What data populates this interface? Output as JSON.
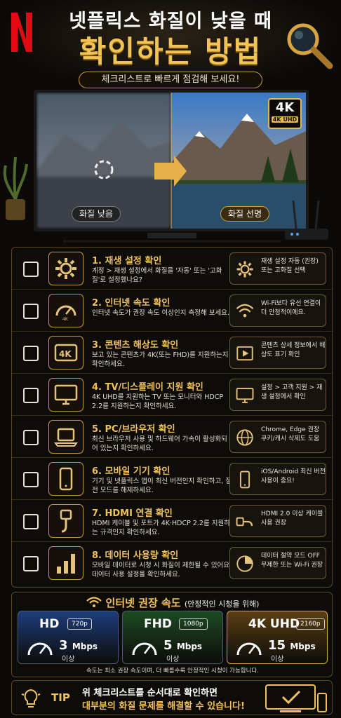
{
  "header": {
    "title_line1": "넷플릭스 화질이 낮을 때",
    "title_line2": "확인하는 방법",
    "subtitle": "체크리스트로 빠르게 점검해 보세요!"
  },
  "tv": {
    "badge_main": "4K",
    "badge_sub": "4K UHD",
    "label_low": "화질 낮음",
    "label_high": "화질 선명"
  },
  "checklist": [
    {
      "icon": "gear-icon",
      "title": "1. 재생 설정 확인",
      "desc": "계정 > 재생 설정에서 화질을 '자동' 또는 '고화질'로 설정했나요?",
      "tip_icon": "gear-icon",
      "tip": "재생 설정 자동 (권장) 또는 고화질 선택"
    },
    {
      "icon": "speedometer-icon",
      "title": "2. 인터넷 속도 확인",
      "desc": "인터넷 속도가 권장 속도 이상인지 측정해 보세요.",
      "tip_icon": "wifi-icon",
      "tip": "Wi-Fi보다 유선 연결이 더 안정적이에요."
    },
    {
      "icon": "4k-badge-icon",
      "title": "3. 콘텐츠 해상도 확인",
      "desc": "보고 있는 콘텐츠가 4K(또는 FHD)를 지원하는지 확인하세요.",
      "tip_icon": "film-icon",
      "tip": "콘텐츠 상세 정보에서 해상도 표기 확인"
    },
    {
      "icon": "monitor-icon",
      "title": "4. TV/디스플레이 지원 확인",
      "desc": "4K UHD를 지원하는 TV 또는 모니터와 HDCP 2.2를 지원하는지 확인하세요.",
      "tip_icon": "monitor-icon",
      "tip": "설정 > 고객 지원 > 재생 설정에서 확인"
    },
    {
      "icon": "laptop-icon",
      "title": "5. PC/브라우저 확인",
      "desc": "최신 브라우저 사용 및 하드웨어 가속이 활성화되어 있는지 확인하세요.",
      "tip_icon": "globe-icon",
      "tip": "Chrome, Edge 권장 쿠키/캐시 삭제도 도움"
    },
    {
      "icon": "phone-icon",
      "title": "6. 모바일 기기 확인",
      "desc": "기기 및 넷플릭스 앱이 최신 버전인지 확인하고, 절전 모드를 해제하세요.",
      "tip_icon": "phone-icon",
      "tip": "iOS/Android 최신 버전 사용이 중요!"
    },
    {
      "icon": "hdmi-icon",
      "title": "7. HDMI 연결 확인",
      "desc": "HDMI 케이블 및 포트가 4K·HDCP 2.2를 지원하는 규격인지 확인하세요.",
      "tip_icon": "cable-icon",
      "tip": "HDMI 2.0 이상 케이블 사용 권장"
    },
    {
      "icon": "bar-chart-icon",
      "title": "8. 데이터 사용량 확인",
      "desc": "모바일 데이터로 시청 시 화질이 제한될 수 있어요. 데이터 사용 설정을 확인하세요.",
      "tip_icon": "pie-chart-icon",
      "tip": "데이터 절약 모드 OFF 무제한 또는 Wi-Fi 권장"
    }
  ],
  "speed": {
    "title": "인터넷 권장 속도",
    "title_note": "(안정적인 시청을 위해)",
    "cards": [
      {
        "name": "HD",
        "res": "720p",
        "value": "3",
        "unit": "Mbps",
        "suffix": "이상",
        "color": "#1d3d7a"
      },
      {
        "name": "FHD",
        "res": "1080p",
        "value": "5",
        "unit": "Mbps",
        "suffix": "이상",
        "color": "#1d4a22"
      },
      {
        "name": "4K UHD",
        "res": "2160p",
        "value": "15",
        "unit": "Mbps",
        "suffix": "이상",
        "color": "#5a3f12"
      }
    ],
    "note": "속도는 최소 권장 속도이며, 더 빠를수록 안정적인 시청이 가능합니다."
  },
  "tipbar": {
    "label": "TIP",
    "line1": "위 체크리스트를 순서대로 확인하면",
    "line2": "대부분의 화질 문제를 해결할 수 있습니다!"
  }
}
